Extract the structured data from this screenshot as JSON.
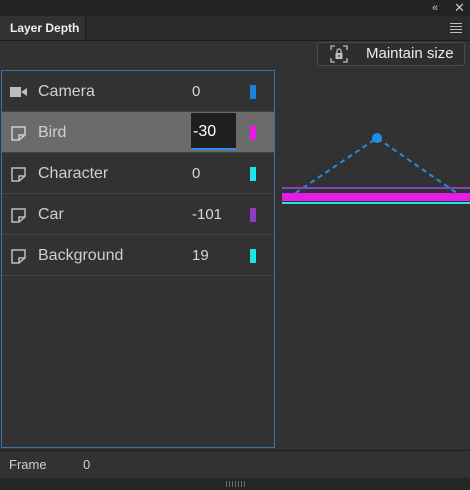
{
  "panel": {
    "tab_label": "Layer Depth",
    "collapse_icon": "double-chevron-left-icon",
    "close_icon": "close-icon",
    "menu_icon": "hamburger-menu-icon"
  },
  "maintain_button": {
    "label": "Maintain size",
    "icon": "lock-icon"
  },
  "layers": [
    {
      "name": "Camera",
      "value": "0",
      "color": "#1e7fdc",
      "icon": "camera-icon",
      "selected": false
    },
    {
      "name": "Bird",
      "value": "-30",
      "color": "#e61be6",
      "icon": "layer-icon",
      "selected": true,
      "editing": true
    },
    {
      "name": "Character",
      "value": "0",
      "color": "#1ee6e6",
      "icon": "layer-icon",
      "selected": false
    },
    {
      "name": "Car",
      "value": "-101",
      "color": "#8b3dc4",
      "icon": "layer-icon",
      "selected": false
    },
    {
      "name": "Background",
      "value": "19",
      "color": "#1ee6e6",
      "icon": "layer-icon",
      "selected": false
    }
  ],
  "footer": {
    "frame_label": "Frame",
    "frame_value": "0"
  }
}
